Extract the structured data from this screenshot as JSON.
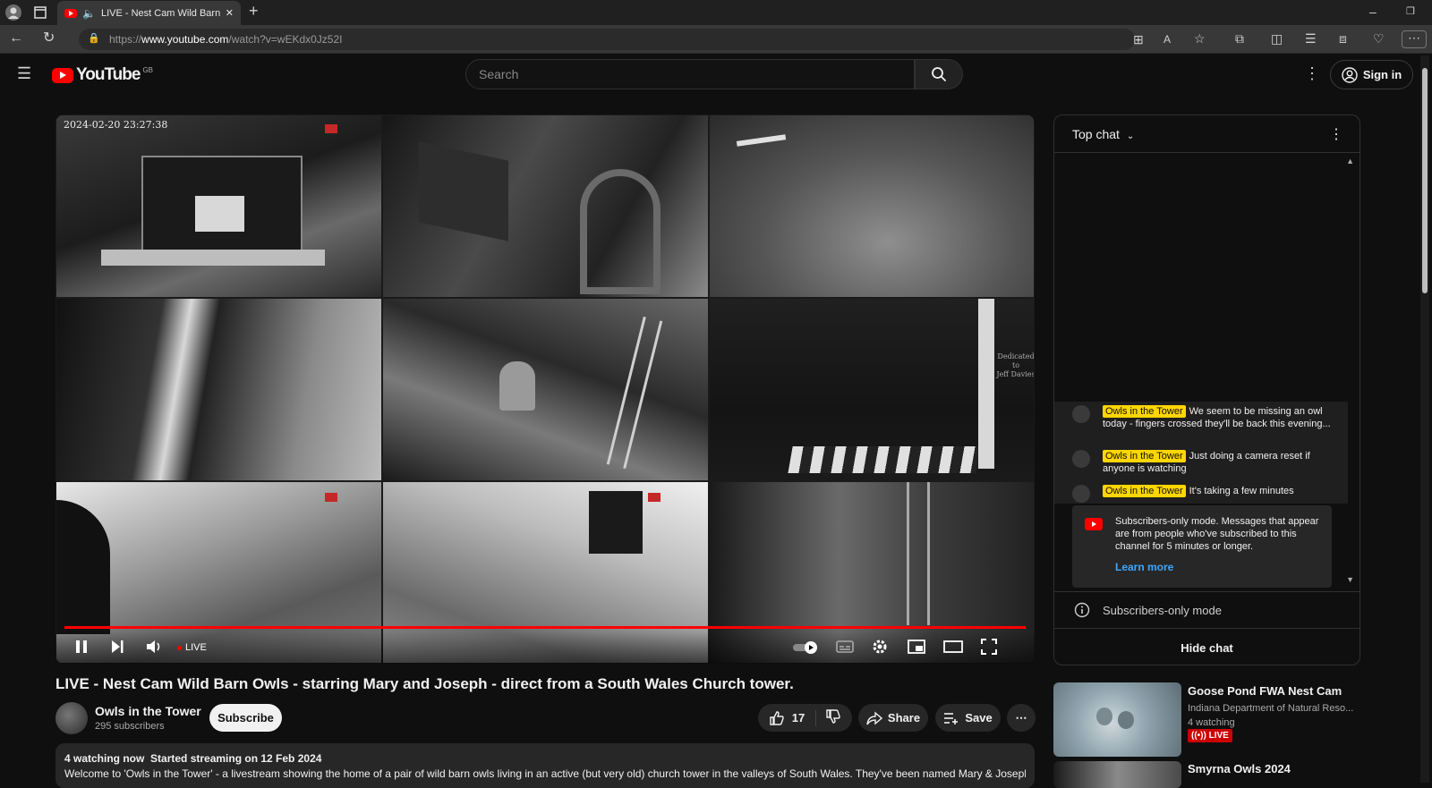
{
  "browser": {
    "tab_title": "LIVE - Nest Cam Wild Barn",
    "url_prefix": "https://",
    "url_host": "www.youtube.com",
    "url_path": "/watch?v=wEKdx0Jz52I"
  },
  "header": {
    "logo_text": "YouTube",
    "region": "GB",
    "search_placeholder": "Search",
    "signin_label": "Sign in"
  },
  "player": {
    "timestamp": "2024-02-20 23:27:38",
    "live_label": "LIVE",
    "cam_overlay_top": "Dedicated",
    "cam_overlay_mid": "to",
    "cam_overlay_bottom": "Jeff Davies"
  },
  "video": {
    "title": "LIVE - Nest Cam Wild Barn Owls - starring Mary and Joseph - direct from a South Wales Church tower.",
    "channel_name": "Owls in the Tower",
    "subscribers": "295 subscribers",
    "subscribe_label": "Subscribe",
    "likes": "17",
    "share_label": "Share",
    "save_label": "Save"
  },
  "description": {
    "watching": "4 watching now",
    "started": "Started streaming on 12 Feb 2024",
    "text": "Welcome to 'Owls in the Tower' - a livestream showing the home of a pair of wild barn owls living in an active (but very old) church tower in the valleys of South Wales. They've been named Mary & Joseph"
  },
  "chat": {
    "header_label": "Top chat",
    "messages": [
      {
        "author": "Owls in the Tower",
        "text": "We seem to be missing an owl today - fingers crossed they'll be back this evening..."
      },
      {
        "author": "Owls in the Tower",
        "text": "Just doing a camera reset if anyone is watching"
      },
      {
        "author": "Owls in the Tower",
        "text": "It's taking a few minutes"
      }
    ],
    "notice_text": "Subscribers-only mode. Messages that appear are from people who've subscribed to this channel for 5 minutes or longer.",
    "learn_more": "Learn more",
    "mode_label": "Subscribers-only mode",
    "hide_label": "Hide chat"
  },
  "recommendations": [
    {
      "title": "Goose Pond FWA Nest Cam",
      "channel": "Indiana Department of Natural Reso...",
      "meta": "4 watching",
      "badge": "LIVE"
    },
    {
      "title": "Smyrna Owls 2024"
    }
  ]
}
